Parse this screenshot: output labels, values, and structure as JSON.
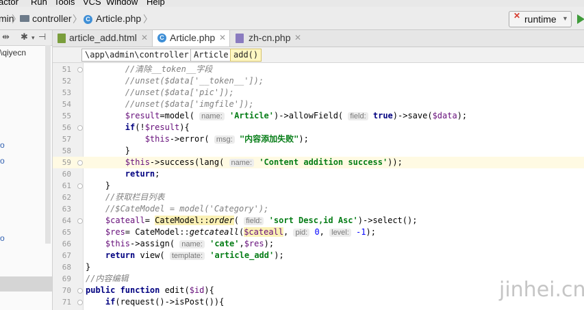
{
  "menu": [
    "actor",
    "Run",
    "Tools",
    "VCS",
    "Window",
    "Help"
  ],
  "navbar": {
    "crumbs": [
      "min",
      "controller",
      "Article.php"
    ],
    "run_config": "runtime"
  },
  "left_panel": {
    "project_fragment": "\\qiyecn",
    "markers": [
      "o",
      "o",
      "o"
    ]
  },
  "tabs": [
    {
      "label": "article_add.html",
      "icon": "html-file-icon"
    },
    {
      "label": "Article.php",
      "icon": "php-class-icon"
    },
    {
      "label": "zh-cn.php",
      "icon": "php-file-icon"
    }
  ],
  "breadcrumb": [
    "\\app\\admin\\controller",
    "Article",
    "add()"
  ],
  "editor": {
    "lines": [
      {
        "n": "51",
        "segs": [
          [
            "cm",
            "        //清除__token__字段"
          ]
        ]
      },
      {
        "n": "52",
        "segs": [
          [
            "cm",
            "        //unset($data['__token__']);"
          ]
        ]
      },
      {
        "n": "53",
        "segs": [
          [
            "cm",
            "        //unset($data['pic']);"
          ]
        ]
      },
      {
        "n": "54",
        "segs": [
          [
            "cm",
            "        //unset($data['imgfile']);"
          ]
        ]
      },
      {
        "n": "55",
        "segs": [
          [
            "var",
            "        $result"
          ],
          [
            "p",
            "=model( "
          ],
          [
            "hint",
            "name:"
          ],
          [
            "p",
            " "
          ],
          [
            "str",
            "'Article'"
          ],
          [
            "p",
            ")->allowField( "
          ],
          [
            "hint",
            "field:"
          ],
          [
            "p",
            " "
          ],
          [
            "kw",
            "true"
          ],
          [
            "p",
            ")->save("
          ],
          [
            "var",
            "$data"
          ],
          [
            "p",
            ");"
          ]
        ]
      },
      {
        "n": "56",
        "segs": [
          [
            "kw",
            "        if"
          ],
          [
            "p",
            "(!"
          ],
          [
            "var",
            "$result"
          ],
          [
            "p",
            "){"
          ]
        ]
      },
      {
        "n": "57",
        "segs": [
          [
            "var",
            "            $this"
          ],
          [
            "p",
            "->error( "
          ],
          [
            "hint",
            "msg:"
          ],
          [
            "p",
            " "
          ],
          [
            "str",
            "\"内容添加失败\""
          ],
          [
            "p",
            ");"
          ]
        ]
      },
      {
        "n": "58",
        "segs": [
          [
            "p",
            "        }"
          ]
        ]
      },
      {
        "n": "59",
        "segs": [
          [
            "var",
            "        $this"
          ],
          [
            "p",
            "->success(lang( "
          ],
          [
            "hint",
            "name:"
          ],
          [
            "p",
            " "
          ],
          [
            "str",
            "'Content addition success'"
          ],
          [
            "p",
            "));"
          ]
        ]
      },
      {
        "n": "60",
        "segs": [
          [
            "kw",
            "        return"
          ],
          [
            "p",
            ";"
          ]
        ]
      },
      {
        "n": "61",
        "segs": [
          [
            "p",
            "    }"
          ]
        ]
      },
      {
        "n": "62",
        "segs": [
          [
            "cm",
            "    //获取栏目列表"
          ]
        ]
      },
      {
        "n": "63",
        "segs": [
          [
            "cm",
            "    //$CateModel = model('Category');"
          ]
        ]
      },
      {
        "n": "64",
        "segs": [
          [
            "var",
            "    $cateall"
          ],
          [
            "p",
            "= "
          ],
          [
            "hl",
            "CateModel::"
          ],
          [
            "hlst",
            "order"
          ],
          [
            "p",
            "( "
          ],
          [
            "hint",
            "field:"
          ],
          [
            "p",
            " "
          ],
          [
            "str",
            "'sort Desc,id Asc'"
          ],
          [
            "p",
            ")->select();"
          ]
        ]
      },
      {
        "n": "65",
        "segs": [
          [
            "var",
            "    $res"
          ],
          [
            "p",
            "= CateModel::"
          ],
          [
            "st",
            "getcateall"
          ],
          [
            "p",
            "("
          ],
          [
            "hlvar",
            "$cateall"
          ],
          [
            "p",
            ", "
          ],
          [
            "hint",
            "pid:"
          ],
          [
            "p",
            " "
          ],
          [
            "num",
            "0"
          ],
          [
            "p",
            ", "
          ],
          [
            "hint",
            "level:"
          ],
          [
            "p",
            " "
          ],
          [
            "num",
            "-1"
          ],
          [
            "p",
            ");"
          ]
        ]
      },
      {
        "n": "66",
        "segs": [
          [
            "var",
            "    $this"
          ],
          [
            "p",
            "->assign( "
          ],
          [
            "hint",
            "name:"
          ],
          [
            "p",
            " "
          ],
          [
            "str",
            "'cate'"
          ],
          [
            "p",
            ","
          ],
          [
            "var",
            "$res"
          ],
          [
            "p",
            ");"
          ]
        ]
      },
      {
        "n": "67",
        "segs": [
          [
            "kw",
            "    return"
          ],
          [
            "p",
            " view( "
          ],
          [
            "hint",
            "template:"
          ],
          [
            "p",
            " "
          ],
          [
            "str",
            "'article_add'"
          ],
          [
            "p",
            ");"
          ]
        ]
      },
      {
        "n": "68",
        "segs": [
          [
            "p",
            "}"
          ]
        ]
      },
      {
        "n": "69",
        "segs": [
          [
            "cm",
            "//内容编辑"
          ]
        ]
      },
      {
        "n": "70",
        "segs": [
          [
            "kw",
            "public function"
          ],
          [
            "p",
            " edit("
          ],
          [
            "var",
            "$id"
          ],
          [
            "p",
            "){"
          ]
        ]
      },
      {
        "n": "71",
        "segs": [
          [
            "kw",
            "    if"
          ],
          [
            "p",
            "(request()->isPost()){"
          ]
        ]
      }
    ],
    "current_line": "59"
  },
  "watermark": "jinhei.cn"
}
